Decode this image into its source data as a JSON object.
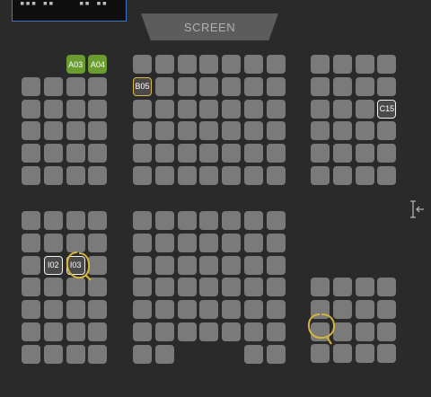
{
  "screen_label": "SCREEN",
  "minimap": {
    "label_left": "▪▪▪ ▪▪",
    "label_right": "▪▪ ▪▪"
  },
  "colors": {
    "background": "#2a2a2a",
    "seat_available": "#7a7a7a",
    "seat_selected": "#6a9c2f",
    "annotation": "#d4b63a"
  },
  "sections": [
    {
      "rows": [
        [
          "",
          "",
          "A03",
          "A04"
        ],
        [
          "",
          "",
          "",
          ""
        ],
        [
          "",
          "",
          "",
          ""
        ],
        [
          "",
          "",
          "",
          ""
        ],
        [
          "",
          "",
          "",
          ""
        ],
        [
          "",
          "",
          "",
          ""
        ]
      ]
    },
    {
      "rows": [
        [
          "",
          "",
          "",
          "",
          "",
          "",
          ""
        ],
        [
          "B05",
          "",
          "",
          "",
          "",
          "",
          ""
        ],
        [
          "",
          "",
          "",
          "",
          "",
          "",
          ""
        ],
        [
          "",
          "",
          "",
          "",
          "",
          "",
          ""
        ],
        [
          "",
          "",
          "",
          "",
          "",
          "",
          ""
        ],
        [
          "",
          "",
          "",
          "",
          "",
          "",
          ""
        ]
      ]
    },
    {
      "rows": [
        [
          "",
          "",
          "",
          ""
        ],
        [
          "",
          "",
          "",
          ""
        ],
        [
          "",
          "",
          "",
          "C15"
        ],
        [
          "",
          "",
          "",
          ""
        ],
        [
          "",
          "",
          "",
          ""
        ],
        [
          "",
          "",
          "",
          ""
        ]
      ]
    },
    {
      "rows": [
        [
          "",
          "",
          "",
          ""
        ],
        [
          "",
          "",
          "",
          ""
        ],
        [
          "",
          "I02",
          "I03",
          ""
        ],
        [
          "",
          "",
          "",
          ""
        ],
        [
          "",
          "",
          "",
          ""
        ],
        [
          "",
          "",
          "",
          ""
        ],
        [
          "",
          "",
          "",
          ""
        ]
      ]
    },
    {
      "rows": [
        [
          "",
          "",
          "",
          "",
          "",
          "",
          ""
        ],
        [
          "",
          "",
          "",
          "",
          "",
          "",
          ""
        ],
        [
          "",
          "",
          "",
          "",
          "",
          "",
          ""
        ],
        [
          "",
          "",
          "",
          "",
          "",
          "",
          ""
        ],
        [
          "",
          "",
          "",
          "",
          "",
          "",
          ""
        ],
        [
          "",
          "",
          "",
          "",
          "",
          "",
          ""
        ],
        [
          "",
          ""
        ]
      ]
    },
    {
      "rows": [
        [
          "",
          "",
          "",
          ""
        ],
        [
          "",
          "",
          "",
          ""
        ],
        [
          "",
          "",
          "",
          ""
        ],
        [
          "",
          "",
          "",
          ""
        ]
      ]
    }
  ],
  "selected_seats": [
    "A03",
    "A04"
  ],
  "highlighted_seats": [
    "B05"
  ]
}
